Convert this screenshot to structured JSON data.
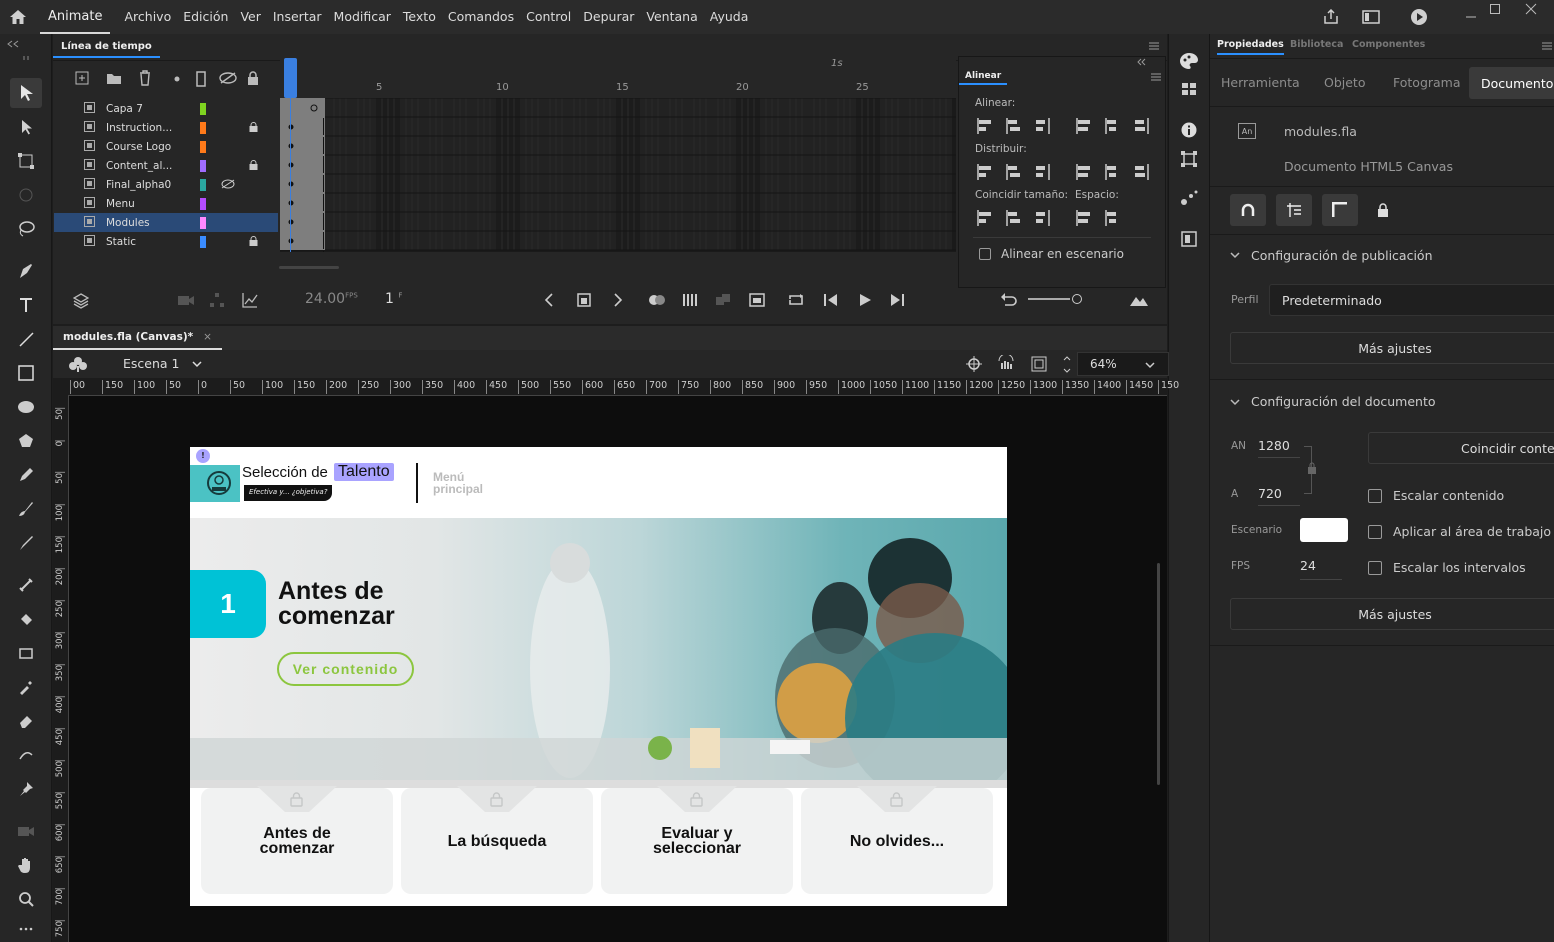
{
  "app": {
    "name": "Animate"
  },
  "menu": [
    "Archivo",
    "Edición",
    "Ver",
    "Insertar",
    "Modificar",
    "Texto",
    "Comandos",
    "Control",
    "Depurar",
    "Ventana",
    "Ayuda"
  ],
  "timeline": {
    "title": "Línea de tiempo",
    "layers": [
      {
        "name": "Capa 7",
        "color": "#7fd320",
        "locked": false,
        "hidden": false
      },
      {
        "name": "Instruction...",
        "color": "#ff7a1a",
        "locked": true,
        "hidden": false
      },
      {
        "name": "Course Logo",
        "color": "#ff7a1a",
        "locked": false,
        "hidden": false
      },
      {
        "name": "Content_al...",
        "color": "#a06cff",
        "locked": true,
        "hidden": false
      },
      {
        "name": "Final_alpha0",
        "color": "#2aa7a0",
        "locked": false,
        "hidden": true
      },
      {
        "name": "Menu",
        "color": "#b44cff",
        "locked": false,
        "hidden": false
      },
      {
        "name": "Modules",
        "color": "#ff88ff",
        "locked": false,
        "hidden": false,
        "selected": true
      },
      {
        "name": "Static",
        "color": "#3a8cff",
        "locked": true,
        "hidden": false
      }
    ],
    "frame_numbers": [
      "5",
      "10",
      "15",
      "20",
      "25"
    ],
    "second_marker": "1s",
    "fps": "24.00",
    "fps_unit": "FPS",
    "current_frame": "1",
    "frame_unit": "F"
  },
  "align_panel": {
    "title": "Alinear",
    "align_label": "Alinear:",
    "distribute_label": "Distribuir:",
    "match_label": "Coincidir tamaño:",
    "space_label": "Espacio:",
    "stage_checkbox": "Alinear en escenario"
  },
  "document_tab": {
    "label": "modules.fla (Canvas)*",
    "close": "×"
  },
  "scene": {
    "label": "Escena 1",
    "zoom": "64%"
  },
  "ruler_h": [
    "00",
    "150",
    "100",
    "50",
    "0",
    "50",
    "100",
    "150",
    "200",
    "250",
    "300",
    "350",
    "400",
    "450",
    "500",
    "550",
    "600",
    "650",
    "700",
    "750",
    "800",
    "850",
    "900",
    "950",
    "1000",
    "1050",
    "1100",
    "1150",
    "1200",
    "1250",
    "1300",
    "1350",
    "1400",
    "1450",
    "150"
  ],
  "ruler_v": [
    "50",
    "0",
    "50",
    "100",
    "150",
    "200",
    "250",
    "300",
    "350",
    "400",
    "450",
    "500",
    "550",
    "600",
    "650",
    "700",
    "750"
  ],
  "stage": {
    "brand": "Selección de",
    "brand_highlight": "Talento",
    "tagline": "Efectiva y... ¿objetiva?",
    "menu_link_1": "Menú",
    "menu_link_2": "principal",
    "module_number": "1",
    "module_title_1": "Antes de",
    "module_title_2": "comenzar",
    "cta": "Ver contenido",
    "cards": [
      {
        "l1": "Antes de",
        "l2": "comenzar"
      },
      {
        "l1": "La búsqueda",
        "l2": ""
      },
      {
        "l1": "Evaluar y",
        "l2": "seleccionar"
      },
      {
        "l1": "No olvides...",
        "l2": ""
      }
    ],
    "badge": "!"
  },
  "right_panel": {
    "tabs": [
      "Propiedades",
      "Biblioteca",
      "Componentes"
    ],
    "subtabs": [
      "Herramienta",
      "Objeto",
      "Fotograma",
      "Documento"
    ],
    "file_name": "modules.fla",
    "doc_type": "Documento HTML5 Canvas",
    "file_icon": "An",
    "publish_section": "Configuración de publicación",
    "profile_label": "Perfil",
    "profile_value": "Predeterminado",
    "more_settings": "Más ajustes",
    "doc_section": "Configuración del documento",
    "width_label": "AN",
    "width_value": "1280",
    "height_label": "A",
    "height_value": "720",
    "match_content": "Coincidir conten",
    "scale_content": "Escalar contenido",
    "apply_workspace": "Aplicar al área de trabajo",
    "scale_spans": "Escalar los intervalos",
    "stage_label": "Escenario",
    "fps_label": "FPS",
    "fps_value": "24",
    "more_settings_2": "Más ajustes"
  }
}
